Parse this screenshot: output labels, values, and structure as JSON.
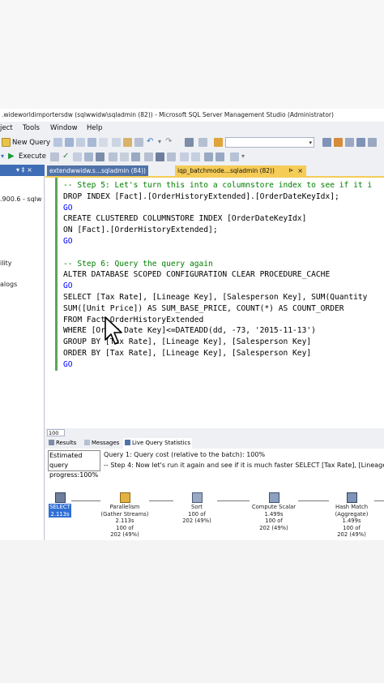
{
  "window": {
    "title": ".wideworldimportersdw (sqlwwidw\\sqladmin (82)) - Microsoft SQL Server Management Studio (Administrator)"
  },
  "menu": [
    "ject",
    "Tools",
    "Window",
    "Help"
  ],
  "toolbar": {
    "new_query": "New Query",
    "execute": "Execute",
    "database_combo_value": ""
  },
  "object_explorer": {
    "header_glyph": "▾ ‡ ×",
    "lines": [
      ".900.6 - sqlw",
      "ility",
      "alogs"
    ]
  },
  "tabs": [
    {
      "label": "extendwwidw.s...sqladmin (84))",
      "active": false
    },
    {
      "label": "iqp_batchmode...sqladmin (82))",
      "active": true
    }
  ],
  "tab_icons": {
    "pin": "pin-icon",
    "close": "close-icon"
  },
  "editor": {
    "lines": [
      "-- Step 5: Let's turn this into a columnstore index to see if it i",
      "DROP INDEX [Fact].[OrderHistoryExtended].[OrderDateKeyIdx];",
      "GO",
      "CREATE CLUSTERED COLUMNSTORE INDEX [OrderDateKeyIdx]",
      "ON [Fact].[OrderHistoryExtended];",
      "GO",
      "",
      "-- Step 6: Query the query again",
      "ALTER DATABASE SCOPED CONFIGURATION CLEAR PROCEDURE_CACHE",
      "GO",
      "SELECT [Tax Rate], [Lineage Key], [Salesperson Key], SUM(Quantity",
      "SUM([Unit Price]) AS SUM_BASE_PRICE, COUNT(*) AS COUNT_ORDER",
      "FROM Fact.OrderHistoryExtended",
      "WHERE [Order Date Key]<=DATEADD(dd, -73, '2015-11-13')",
      "GROUP BY [Tax Rate], [Lineage Key], [Salesperson Key]",
      "ORDER BY [Tax Rate], [Lineage Key], [Salesperson Key]",
      "GO"
    ],
    "zoom": "100 %"
  },
  "results": {
    "tabs": [
      "Results",
      "Messages",
      "Live Query Statistics"
    ],
    "progress_label_1": "Estimated query",
    "progress_label_2": "progress:100%",
    "query_line_1": "Query 1: Query cost (relative to the batch): 100%",
    "query_line_2": "-- Step 4: Now let's run it again and see if it is much faster SELECT [Tax Rate], [Lineage"
  },
  "plan": {
    "operators": [
      {
        "name": "SELECT",
        "line2": "2.113s",
        "lines": []
      },
      {
        "name": "Parallelism",
        "line2": "(Gather Streams)",
        "lines": [
          "2.113s",
          "100 of",
          "202 (49%)"
        ]
      },
      {
        "name": "Sort",
        "line2": "",
        "lines": [
          "100 of",
          "202 (49%)"
        ]
      },
      {
        "name": "Compute Scalar",
        "line2": "",
        "lines": [
          "1.499s",
          "100 of",
          "202 (49%)"
        ]
      },
      {
        "name": "Hash Match",
        "line2": "(Aggregate)",
        "lines": [
          "1.499s",
          "100 of",
          "202 (49%)"
        ]
      }
    ]
  },
  "colors": {
    "accent_blue": "#3e6db5",
    "tab_active_yellow": "#f5cc57",
    "keyword_blue": "#0000ff",
    "comment_green": "#008000",
    "string_red": "#d03030",
    "function_magenta": "#d52dc2"
  }
}
